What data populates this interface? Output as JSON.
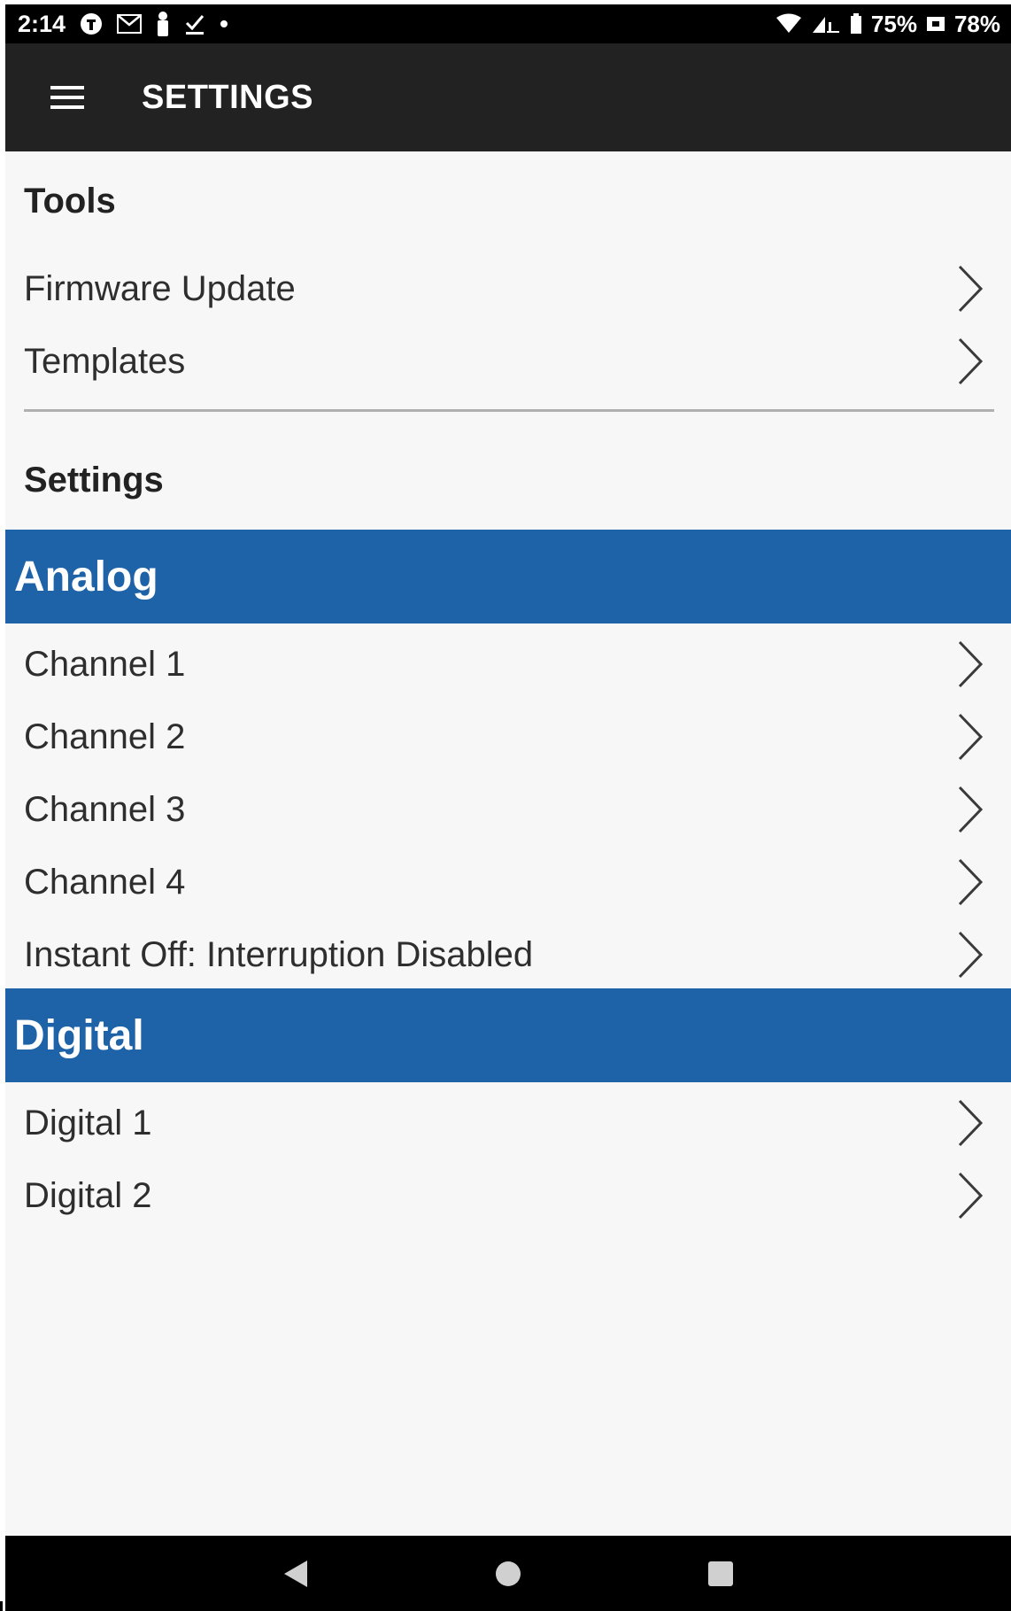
{
  "status_bar": {
    "time": "2:14",
    "left_icons": [
      "tesla-icon",
      "gmail-icon",
      "person-icon",
      "download-check-icon",
      "dot-icon"
    ],
    "right_icons": [
      "wifi-icon",
      "signal-icon"
    ],
    "battery1": "75%",
    "battery2": "78%"
  },
  "app_bar": {
    "title": "SETTINGS",
    "menu_icon": "hamburger-icon"
  },
  "tools": {
    "heading": "Tools",
    "items": [
      {
        "label": "Firmware Update"
      },
      {
        "label": "Templates"
      }
    ]
  },
  "settings": {
    "heading": "Settings"
  },
  "analog": {
    "title": "Analog",
    "items": [
      {
        "label": "Channel 1"
      },
      {
        "label": "Channel 2"
      },
      {
        "label": "Channel 3"
      },
      {
        "label": "Channel 4"
      },
      {
        "label": "Instant Off: Interruption Disabled"
      }
    ]
  },
  "digital": {
    "title": "Digital",
    "items": [
      {
        "label": "Digital 1"
      },
      {
        "label": "Digital 2"
      }
    ]
  },
  "nav_bar": {
    "buttons": [
      "back-icon",
      "home-icon",
      "recents-icon"
    ]
  },
  "colors": {
    "app_bar": "#222222",
    "group_header": "#1e62a8",
    "background": "#f7f7f7",
    "text": "#2e2e2e"
  }
}
